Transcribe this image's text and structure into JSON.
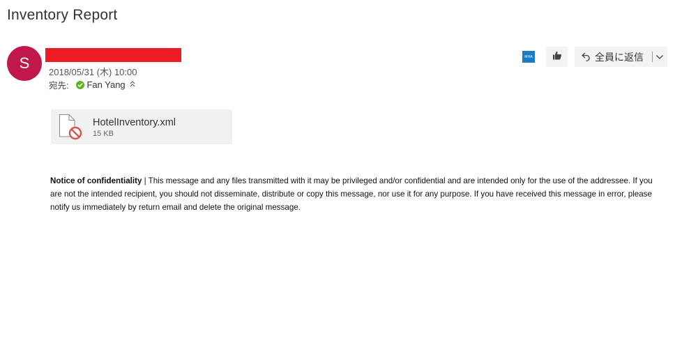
{
  "email": {
    "subject": "Inventory Report",
    "sender_initial": "S",
    "date": "2018/05/31 (木) 10:00",
    "to_label": "宛先:",
    "recipient": "Fan Yang"
  },
  "toolbar": {
    "mha_label": "MHA",
    "reply_all_label": "全員に返信"
  },
  "attachment": {
    "filename": "HotelInventory.xml",
    "size": "15 KB"
  },
  "body": {
    "notice_title": "Notice of confidentiality",
    "notice_text": " | This message and any files transmitted with it may be privileged and/or confidential and are intended only for the use of the addressee. If you are not the intended recipient, you should not disseminate, distribute or copy this message, nor use it for any purpose. If you have received this message in error, please notify us immediately by return email and delete the original message."
  },
  "colors": {
    "avatar": "#c0184a",
    "redaction": "#ed1c24",
    "check": "#5db324",
    "mha": "#1b7cc4",
    "button_bg": "#f3f3f3"
  }
}
